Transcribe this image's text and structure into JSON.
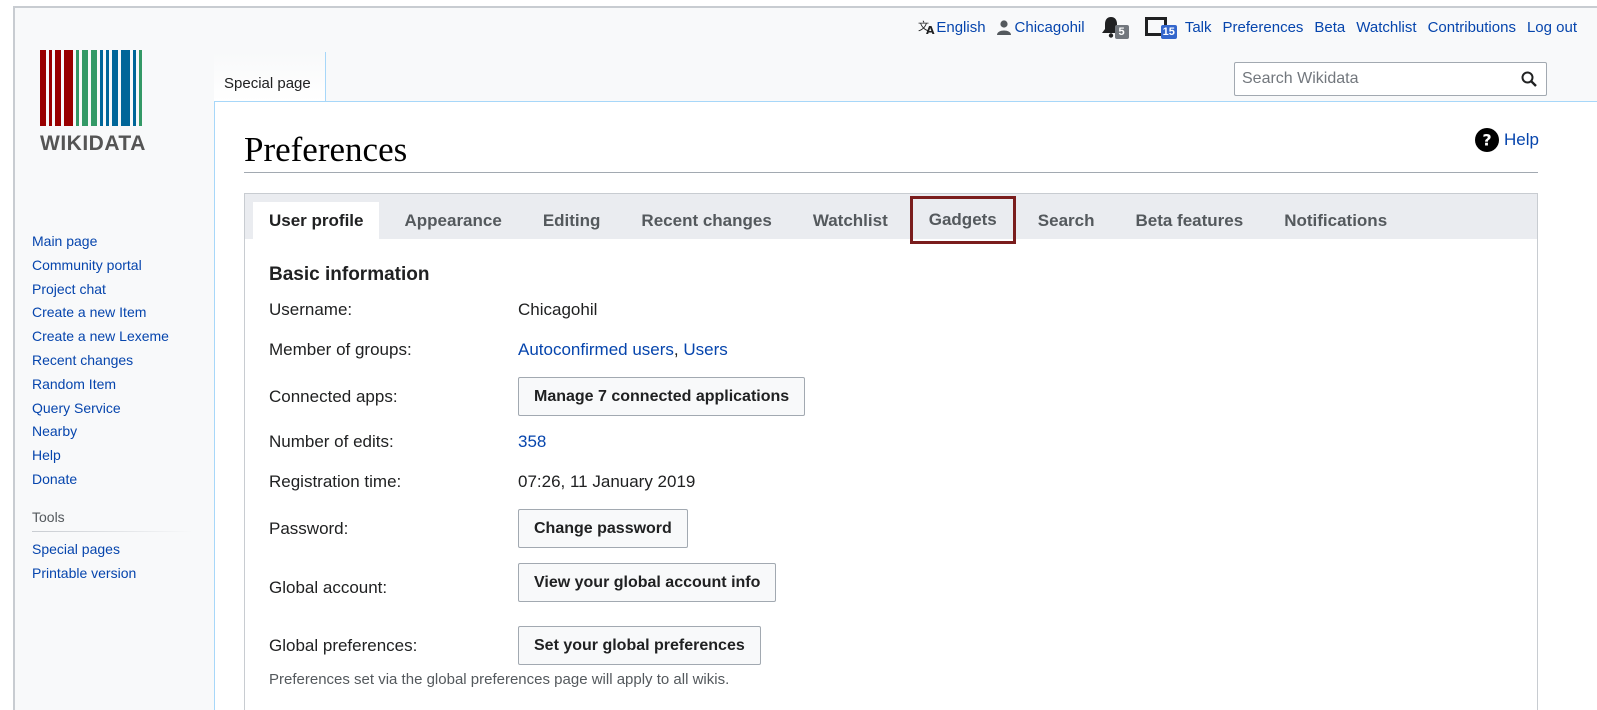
{
  "personal_bar": {
    "language": "English",
    "username": "Chicagohil",
    "notifications_count": "5",
    "messages_count": "15",
    "talk": "Talk",
    "preferences": "Preferences",
    "beta": "Beta",
    "watchlist": "Watchlist",
    "contributions": "Contributions",
    "logout": "Log out"
  },
  "logo": {
    "text": "WIKIDATA",
    "bar_colors": [
      "#990000",
      "#990000",
      "#990000",
      "#990000",
      "#339966",
      "#339966",
      "#339966",
      "#006699",
      "#006699",
      "#006699",
      "#006699",
      "#006699",
      "#339966"
    ]
  },
  "page_tab": "Special page",
  "search": {
    "placeholder": "Search Wikidata"
  },
  "sidebar": {
    "items": [
      "Main page",
      "Community portal",
      "Project chat",
      "Create a new Item",
      "Create a new Lexeme",
      "Recent changes",
      "Random Item",
      "Query Service",
      "Nearby",
      "Help",
      "Donate"
    ],
    "tools_heading": "Tools",
    "tools": [
      "Special pages",
      "Printable version"
    ]
  },
  "page": {
    "title": "Preferences",
    "help": "Help"
  },
  "tabs": [
    "User profile",
    "Appearance",
    "Editing",
    "Recent changes",
    "Watchlist",
    "Gadgets",
    "Search",
    "Beta features",
    "Notifications"
  ],
  "basic": {
    "title": "Basic information",
    "username_label": "Username:",
    "username_value": "Chicagohil",
    "groups_label": "Member of groups:",
    "group1": "Autoconfirmed users",
    "group_sep": ", ",
    "group2": "Users",
    "apps_label": "Connected apps:",
    "apps_button": "Manage 7 connected applications",
    "edits_label": "Number of edits:",
    "edits_value": "358",
    "regtime_label": "Registration time:",
    "regtime_value": "07:26, 11 January 2019",
    "password_label": "Password:",
    "password_button": "Change password",
    "global_label": "Global account:",
    "global_button": "View your global account info",
    "globalprefs_label": "Global preferences:",
    "globalprefs_button": "Set your global preferences",
    "note": "Preferences set via the global preferences page will apply to all wikis."
  },
  "colors": {
    "link": "#0645ad",
    "highlight": "#7a1d1d"
  }
}
